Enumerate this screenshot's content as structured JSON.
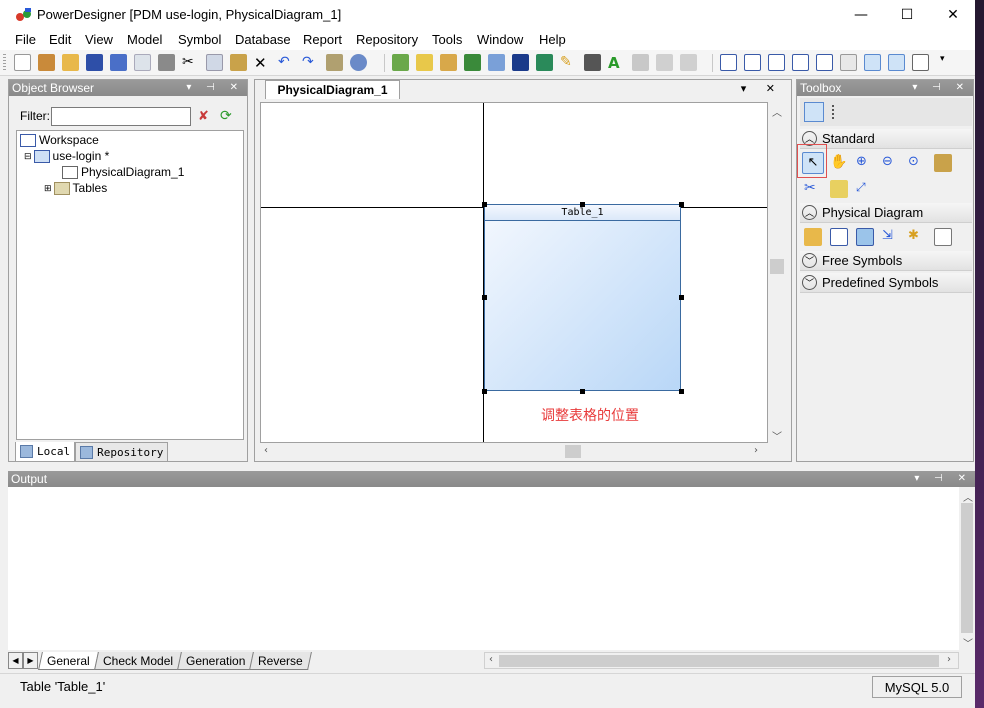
{
  "window": {
    "title": "PowerDesigner [PDM use-login, PhysicalDiagram_1]",
    "controls": {
      "minimize": "—",
      "maximize": "☐",
      "close": "✕"
    }
  },
  "menu": [
    "File",
    "Edit",
    "View",
    "Model",
    "Symbol",
    "Database",
    "Report",
    "Repository",
    "Tools",
    "Window",
    "Help"
  ],
  "object_browser": {
    "title": "Object Browser",
    "filter_label": "Filter:",
    "filter_value": "",
    "tree": {
      "workspace": "Workspace",
      "model": "use-login *",
      "diagram": "PhysicalDiagram_1",
      "tables": "Tables"
    },
    "tabs": [
      "Local",
      "Repository"
    ]
  },
  "diagram": {
    "tab_label": "PhysicalDiagram_1",
    "table_name": "Table_1",
    "annotation": "调整表格的位置"
  },
  "toolbox": {
    "title": "Toolbox",
    "sections": [
      "Standard",
      "Physical Diagram",
      "Free Symbols",
      "Predefined Symbols"
    ]
  },
  "output": {
    "title": "Output",
    "tabs": [
      "General",
      "Check Model",
      "Generation",
      "Reverse"
    ]
  },
  "status": {
    "text": "Table 'Table_1'",
    "dbms": "MySQL 5.0"
  },
  "colors": {
    "panel_header": "#8f8f8f",
    "annotation": "#e83a3a",
    "table_fill_start": "#f4f8fe",
    "table_fill_end": "#b9d7f7",
    "highlight_box": "#e05050"
  }
}
